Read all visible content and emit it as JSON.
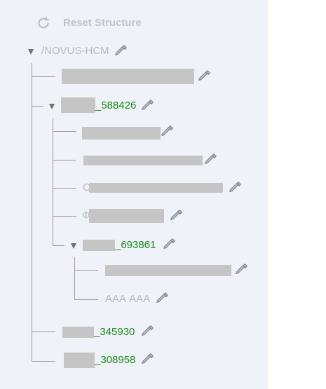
{
  "toolbar": {
    "reset_label": "Reset Structure",
    "reset_icon": "refresh-icon"
  },
  "tree": {
    "root": {
      "label": "/NOVUS-HCM"
    },
    "n1_suffix": "_588426",
    "n1_children": {
      "c3_prefix": "С",
      "c4_prefix": "Ф",
      "n2_suffix": "_693861",
      "n2_children": {
        "d2_label": "ААА ААА"
      }
    },
    "n3_suffix": "_345930",
    "n4_suffix": "_308958"
  },
  "colors": {
    "panel_bg": "#eff2f8",
    "link_green": "#1b8a1b",
    "muted_text": "#b6b9bf",
    "redaction": "#c5c5c5"
  }
}
